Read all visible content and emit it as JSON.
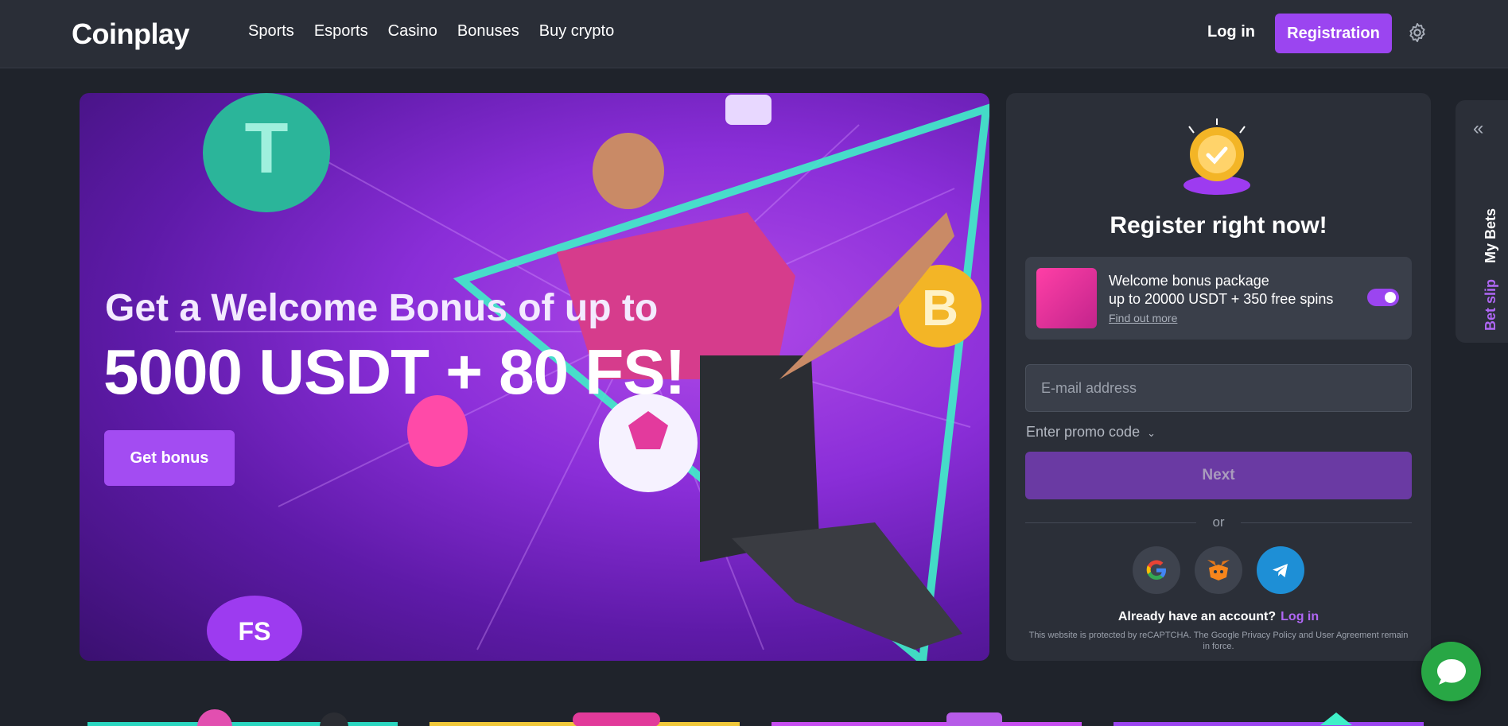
{
  "header": {
    "logo": "Coinplay",
    "nav": [
      "Sports",
      "Esports",
      "Casino",
      "Bonuses",
      "Buy crypto"
    ],
    "login_label": "Log in",
    "register_label": "Registration"
  },
  "hero": {
    "title_line1": "Get a Welcome Bonus of up to",
    "title_line2": "5000 USDT + 80 FS!",
    "cta_label": "Get bonus",
    "accent_color": "#9b45f0"
  },
  "register": {
    "title": "Register right now!",
    "bonus": {
      "line1": "Welcome bonus package",
      "line2": "up to 20000 USDT + 350 free spins",
      "link": "Find out more",
      "enabled": true
    },
    "email_placeholder": "E-mail address",
    "promo_label": "Enter promo code",
    "next_label": "Next",
    "or_label": "or",
    "social": [
      "google-icon",
      "metamask-icon",
      "telegram-icon"
    ],
    "already_label": "Already have an account?",
    "already_link": "Log in",
    "recaptcha_text": "This website is protected by reCAPTCHA. The Google Privacy Policy and User Agreement remain in force."
  },
  "side_tab": {
    "bet_slip": "Bet slip",
    "my_bets": "My Bets"
  }
}
